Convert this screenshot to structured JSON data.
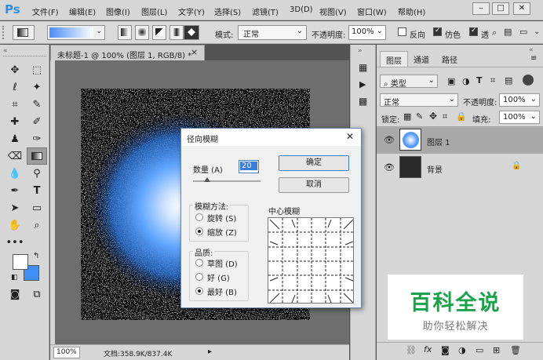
{
  "app": {
    "logo": "Ps"
  },
  "menu": [
    "文件(F)",
    "编辑(E)",
    "图像(I)",
    "图层(L)",
    "文字(Y)",
    "选择(S)",
    "滤镜(T)",
    "3D(D)",
    "视图(V)",
    "窗口(W)",
    "帮助(H)"
  ],
  "options": {
    "mode_label": "模式:",
    "mode_value": "正常",
    "opacity_label": "不透明度:",
    "opacity_value": "100%",
    "reverse_label": "反向",
    "dither_label": "仿色",
    "transparency_label": "透"
  },
  "document": {
    "tab_title": "未标题-1 @ 100% (图层 1, RGB/8) *",
    "close": "×",
    "zoom": "100%",
    "doc_size": "文档:358.9K/837.4K"
  },
  "layers_panel": {
    "tabs": [
      "图层",
      "通道",
      "路径"
    ],
    "filter_kind": "类型",
    "blend_mode": "正常",
    "opacity_label": "不透明度:",
    "opacity_value": "100%",
    "lock_label": "锁定:",
    "fill_label": "填充:",
    "fill_value": "100%",
    "layers": [
      {
        "name": "图层 1",
        "selected": true
      },
      {
        "name": "背景",
        "selected": false
      }
    ]
  },
  "dialog": {
    "title": "径向模糊",
    "amount_label": "数量 (A)",
    "amount_value": "20",
    "ok": "确定",
    "cancel": "取消",
    "method_title": "模糊方法:",
    "method_spin": "旋转 (S)",
    "method_zoom": "缩放 (Z)",
    "quality_title": "品质:",
    "quality_draft": "草图 (D)",
    "quality_good": "好 (G)",
    "quality_best": "最好 (B)",
    "center_label": "中心模糊"
  },
  "watermark": {
    "brand": "百科全说",
    "tagline": "助你轻松解决"
  },
  "colors": {
    "accent_blue": "#2f8fe3",
    "glow_blue": "#3d8ff5",
    "brand_green": "#1aa34a"
  }
}
